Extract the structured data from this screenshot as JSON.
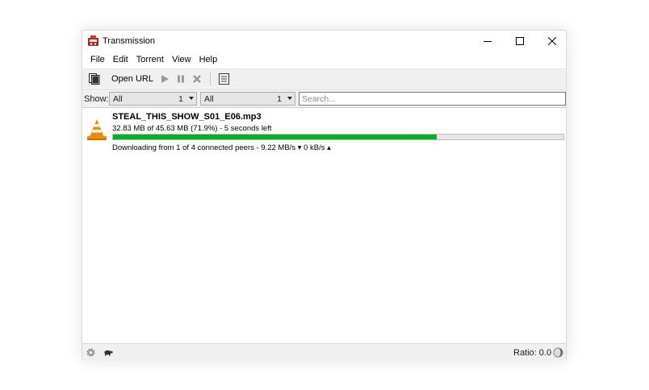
{
  "window": {
    "title": "Transmission"
  },
  "menu": [
    {
      "label": "File"
    },
    {
      "label": "Edit"
    },
    {
      "label": "Torrent"
    },
    {
      "label": "View"
    },
    {
      "label": "Help"
    }
  ],
  "toolbar": {
    "open_url_label": "Open URL",
    "icons": [
      "open-torrent-icon",
      "play-icon",
      "pause-icon",
      "remove-icon",
      "properties-icon"
    ]
  },
  "filter": {
    "show_label": "Show:",
    "status_filter": {
      "selected": "All",
      "count": "1"
    },
    "tracker_filter": {
      "selected": "All",
      "count": "1"
    },
    "search_placeholder": "Search..."
  },
  "torrents": [
    {
      "name": "STEAL_THIS_SHOW_S01_E06.mp3",
      "progress_text": "32.83 MB of 45.63 MB (71.9%) - 5 seconds left",
      "progress_fraction": 0.719,
      "status_text": "Downloading from 1 of 4 connected peers - 9.22 MB/s ▾  0 kB/s ▴",
      "icon": "vlc-cone-icon"
    }
  ],
  "statusbar": {
    "ratio_text": "Ratio: 0.0"
  },
  "colors": {
    "progress": "#06b025",
    "toolbar_bg": "#f0f0f0",
    "vlc_orange": "#f08a00"
  }
}
